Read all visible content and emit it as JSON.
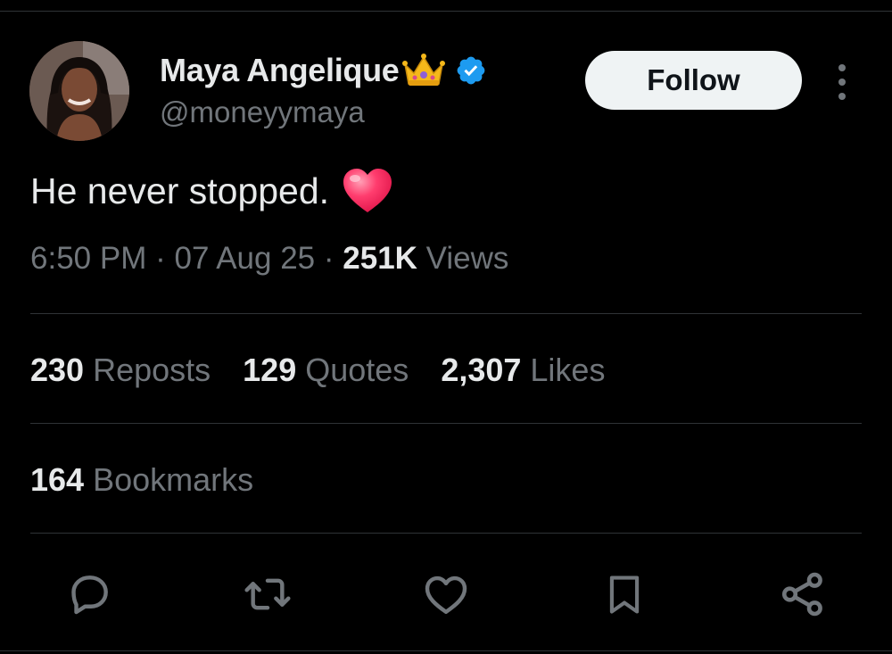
{
  "author": {
    "display_name": "Maya Angelique",
    "handle": "@moneyymaya",
    "name_emoji": "crown-emoji",
    "verified": true
  },
  "follow_button": {
    "label": "Follow"
  },
  "tweet": {
    "text": "He never stopped.",
    "emoji": "red-heart-emoji"
  },
  "meta": {
    "time": "6:50 PM",
    "separator": "·",
    "date": "07 Aug 25",
    "views_count": "251K",
    "views_label": "Views"
  },
  "stats": [
    {
      "count": "230",
      "label": "Reposts"
    },
    {
      "count": "129",
      "label": "Quotes"
    },
    {
      "count": "2,307",
      "label": "Likes"
    }
  ],
  "bookmarks": {
    "count": "164",
    "label": "Bookmarks"
  },
  "actions": [
    "reply-icon",
    "repost-icon",
    "like-icon",
    "bookmark-icon",
    "share-icon"
  ],
  "colors": {
    "background": "#000000",
    "primary_text": "#e7e9ea",
    "secondary_text": "#71767b",
    "divider": "#2f3336",
    "verified_blue": "#1d9bf0",
    "follow_bg": "#eff3f4"
  }
}
